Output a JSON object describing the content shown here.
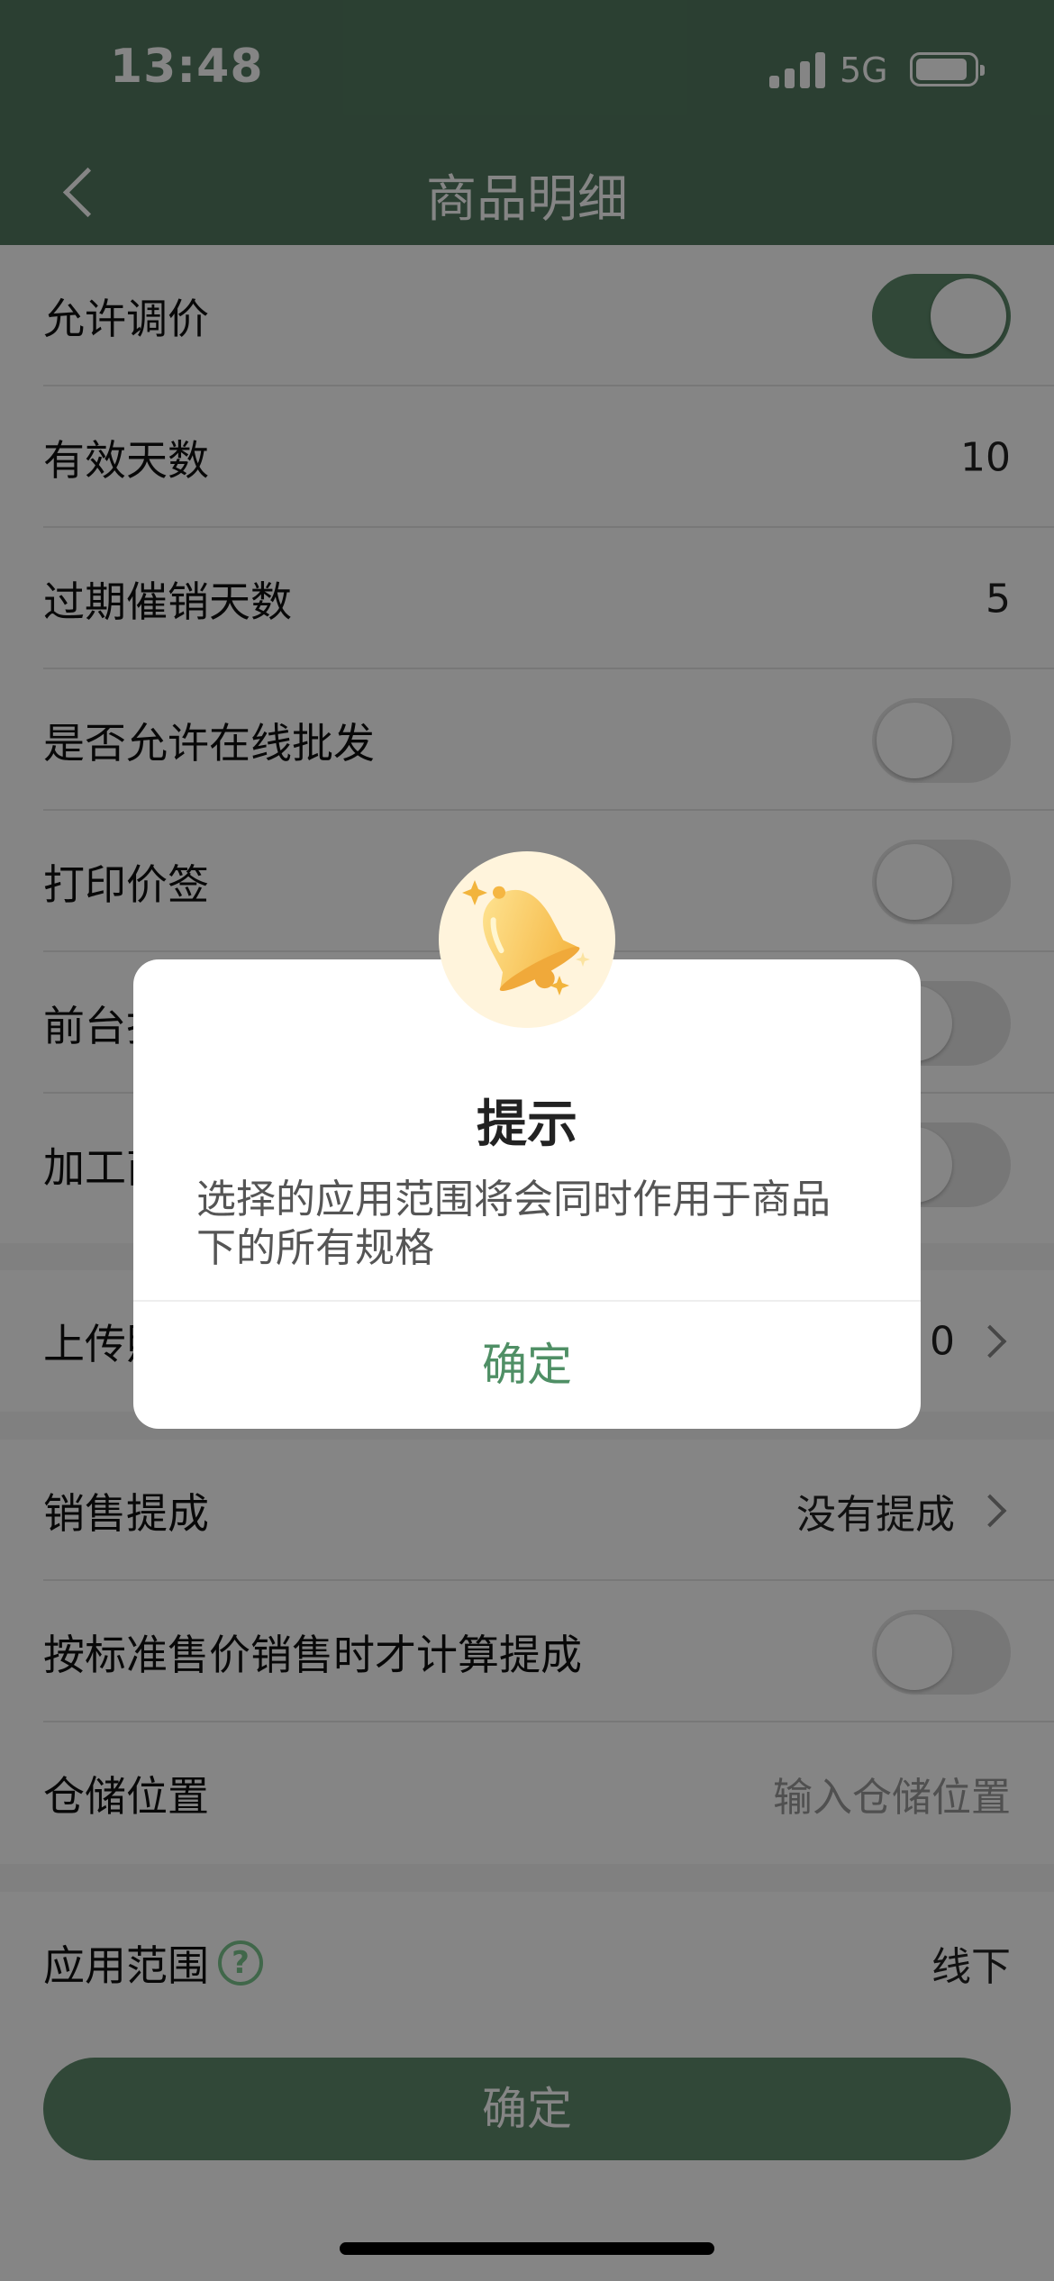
{
  "status_bar": {
    "time": "13:48",
    "network": "5G"
  },
  "nav": {
    "title": "商品明细"
  },
  "settings": {
    "allow_price_adjust": {
      "label": "允许调价",
      "on": true
    },
    "valid_days": {
      "label": "有效天数",
      "value": "10"
    },
    "expiry_promo_days": {
      "label": "过期催销天数",
      "value": "5"
    },
    "allow_online_wholesale": {
      "label": "是否允许在线批发",
      "on": false
    },
    "print_price_tag": {
      "label": "打印价签",
      "on": false
    },
    "front_row": {
      "label": "前台打",
      "on": false
    },
    "processing_row": {
      "label": "加工商",
      "on": false
    }
  },
  "upload_row": {
    "label": "上传照",
    "value": "0"
  },
  "commission": {
    "sales_commission": {
      "label": "销售提成",
      "value": "没有提成"
    },
    "standard_price_commission": {
      "label": "按标准售价销售时才计算提成",
      "on": false
    },
    "storage_location": {
      "label": "仓储位置",
      "placeholder": "输入仓储位置"
    }
  },
  "scope": {
    "label": "应用范围",
    "help": "?",
    "value": "线下"
  },
  "confirm_button": "确定",
  "dialog": {
    "title": "提示",
    "message": "选择的应用范围将会同时作用于商品下的所有规格",
    "confirm": "确定"
  },
  "colors": {
    "primary": "#5e8b6c",
    "dialog_button": "#4f8f65",
    "help_icon": "#7cc58e"
  }
}
